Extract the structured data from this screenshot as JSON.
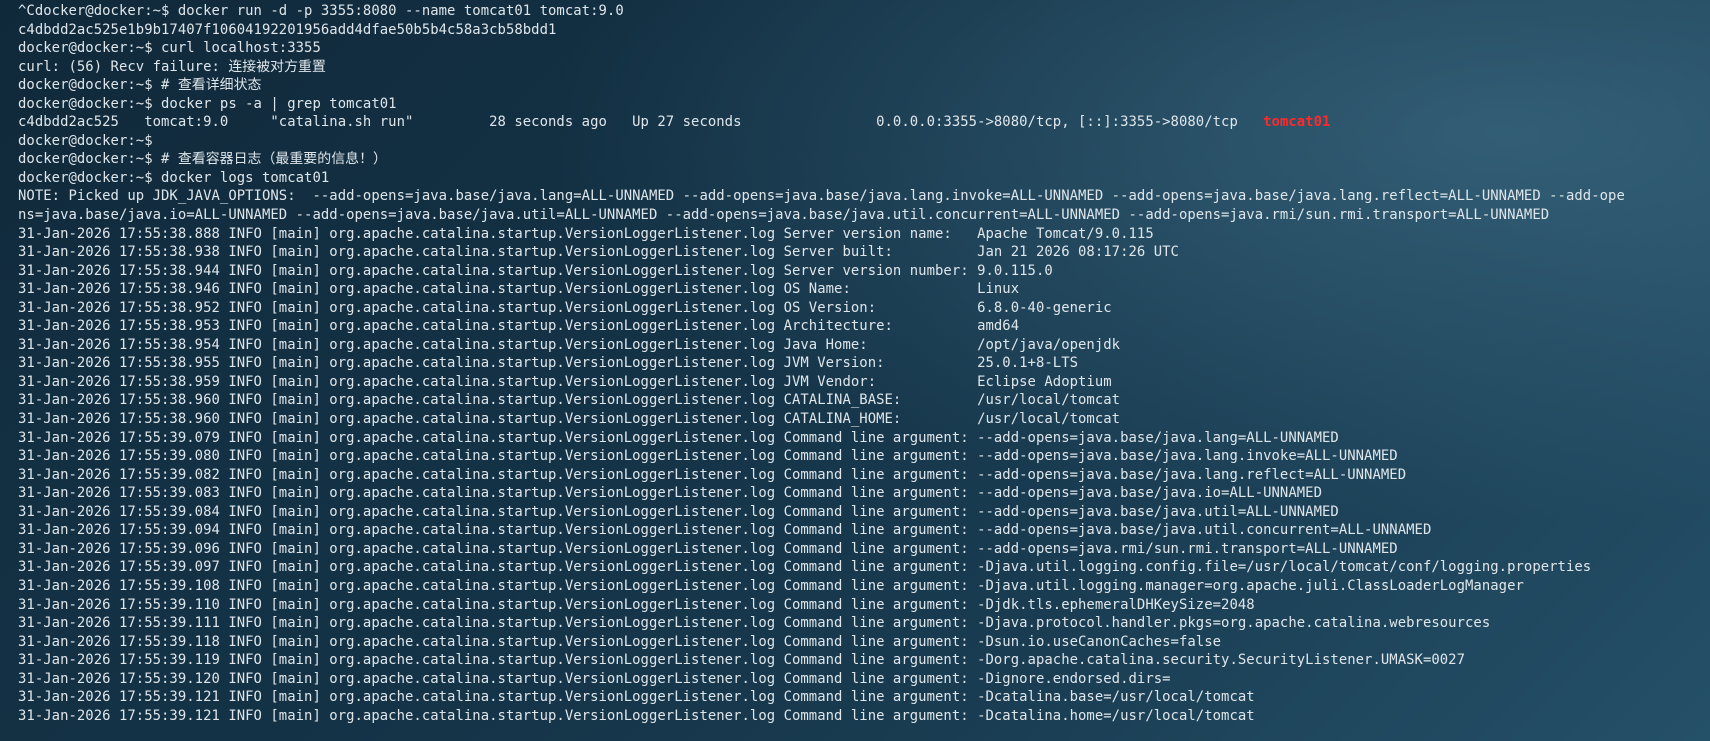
{
  "terminal": {
    "top_clip": "  ",
    "lines": [
      "^Cdocker@docker:~$ docker run -d -p 3355:8080 --name tomcat01 tomcat:9.0",
      "c4dbdd2ac525e1b9b17407f10604192201956add4dfae50b5b4c58a3cb58bdd1",
      "docker@docker:~$ curl localhost:3355",
      "curl: (56) Recv failure: 连接被对方重置",
      "docker@docker:~$ # 查看详细状态",
      "docker@docker:~$ docker ps -a | grep tomcat01",
      "docker@docker:~$ ",
      "docker@docker:~$ # 查看容器日志（最重要的信息！）",
      "docker@docker:~$ docker logs tomcat01",
      "NOTE: Picked up JDK_JAVA_OPTIONS:  --add-opens=java.base/java.lang=ALL-UNNAMED --add-opens=java.base/java.lang.invoke=ALL-UNNAMED --add-opens=java.base/java.lang.reflect=ALL-UNNAMED --add-ope",
      "ns=java.base/java.io=ALL-UNNAMED --add-opens=java.base/java.util=ALL-UNNAMED --add-opens=java.base/java.util.concurrent=ALL-UNNAMED --add-opens=java.rmi/sun.rmi.transport=ALL-UNNAMED",
      "31-Jan-2026 17:55:38.888 INFO [main] org.apache.catalina.startup.VersionLoggerListener.log Server version name:   Apache Tomcat/9.0.115",
      "31-Jan-2026 17:55:38.938 INFO [main] org.apache.catalina.startup.VersionLoggerListener.log Server built:          Jan 21 2026 08:17:26 UTC",
      "31-Jan-2026 17:55:38.944 INFO [main] org.apache.catalina.startup.VersionLoggerListener.log Server version number: 9.0.115.0",
      "31-Jan-2026 17:55:38.946 INFO [main] org.apache.catalina.startup.VersionLoggerListener.log OS Name:               Linux",
      "31-Jan-2026 17:55:38.952 INFO [main] org.apache.catalina.startup.VersionLoggerListener.log OS Version:            6.8.0-40-generic",
      "31-Jan-2026 17:55:38.953 INFO [main] org.apache.catalina.startup.VersionLoggerListener.log Architecture:          amd64",
      "31-Jan-2026 17:55:38.954 INFO [main] org.apache.catalina.startup.VersionLoggerListener.log Java Home:             /opt/java/openjdk",
      "31-Jan-2026 17:55:38.955 INFO [main] org.apache.catalina.startup.VersionLoggerListener.log JVM Version:           25.0.1+8-LTS",
      "31-Jan-2026 17:55:38.959 INFO [main] org.apache.catalina.startup.VersionLoggerListener.log JVM Vendor:            Eclipse Adoptium",
      "31-Jan-2026 17:55:38.960 INFO [main] org.apache.catalina.startup.VersionLoggerListener.log CATALINA_BASE:         /usr/local/tomcat",
      "31-Jan-2026 17:55:38.960 INFO [main] org.apache.catalina.startup.VersionLoggerListener.log CATALINA_HOME:         /usr/local/tomcat",
      "31-Jan-2026 17:55:39.079 INFO [main] org.apache.catalina.startup.VersionLoggerListener.log Command line argument: --add-opens=java.base/java.lang=ALL-UNNAMED",
      "31-Jan-2026 17:55:39.080 INFO [main] org.apache.catalina.startup.VersionLoggerListener.log Command line argument: --add-opens=java.base/java.lang.invoke=ALL-UNNAMED",
      "31-Jan-2026 17:55:39.082 INFO [main] org.apache.catalina.startup.VersionLoggerListener.log Command line argument: --add-opens=java.base/java.lang.reflect=ALL-UNNAMED",
      "31-Jan-2026 17:55:39.083 INFO [main] org.apache.catalina.startup.VersionLoggerListener.log Command line argument: --add-opens=java.base/java.io=ALL-UNNAMED",
      "31-Jan-2026 17:55:39.084 INFO [main] org.apache.catalina.startup.VersionLoggerListener.log Command line argument: --add-opens=java.base/java.util=ALL-UNNAMED",
      "31-Jan-2026 17:55:39.094 INFO [main] org.apache.catalina.startup.VersionLoggerListener.log Command line argument: --add-opens=java.base/java.util.concurrent=ALL-UNNAMED",
      "31-Jan-2026 17:55:39.096 INFO [main] org.apache.catalina.startup.VersionLoggerListener.log Command line argument: --add-opens=java.rmi/sun.rmi.transport=ALL-UNNAMED",
      "31-Jan-2026 17:55:39.097 INFO [main] org.apache.catalina.startup.VersionLoggerListener.log Command line argument: -Djava.util.logging.config.file=/usr/local/tomcat/conf/logging.properties",
      "31-Jan-2026 17:55:39.108 INFO [main] org.apache.catalina.startup.VersionLoggerListener.log Command line argument: -Djava.util.logging.manager=org.apache.juli.ClassLoaderLogManager",
      "31-Jan-2026 17:55:39.110 INFO [main] org.apache.catalina.startup.VersionLoggerListener.log Command line argument: -Djdk.tls.ephemeralDHKeySize=2048",
      "31-Jan-2026 17:55:39.111 INFO [main] org.apache.catalina.startup.VersionLoggerListener.log Command line argument: -Djava.protocol.handler.pkgs=org.apache.catalina.webresources",
      "31-Jan-2026 17:55:39.118 INFO [main] org.apache.catalina.startup.VersionLoggerListener.log Command line argument: -Dsun.io.useCanonCaches=false",
      "31-Jan-2026 17:55:39.119 INFO [main] org.apache.catalina.startup.VersionLoggerListener.log Command line argument: -Dorg.apache.catalina.security.SecurityListener.UMASK=0027",
      "31-Jan-2026 17:55:39.120 INFO [main] org.apache.catalina.startup.VersionLoggerListener.log Command line argument: -Dignore.endorsed.dirs=",
      "31-Jan-2026 17:55:39.121 INFO [main] org.apache.catalina.startup.VersionLoggerListener.log Command line argument: -Dcatalina.base=/usr/local/tomcat",
      "31-Jan-2026 17:55:39.121 INFO [main] org.apache.catalina.startup.VersionLoggerListener.log Command line argument: -Dcatalina.home=/usr/local/tomcat"
    ],
    "ps_row": {
      "before": "c4dbdd2ac525   tomcat:9.0     \"catalina.sh run\"         28 seconds ago   Up 27 seconds                0.0.0.0:3355->8080/tcp, [::]:3355->8080/tcp   ",
      "highlight": "tomcat01"
    },
    "colors": {
      "text": "#dfe6ea",
      "highlight": "#ff2a2a",
      "background": "#143246"
    }
  }
}
